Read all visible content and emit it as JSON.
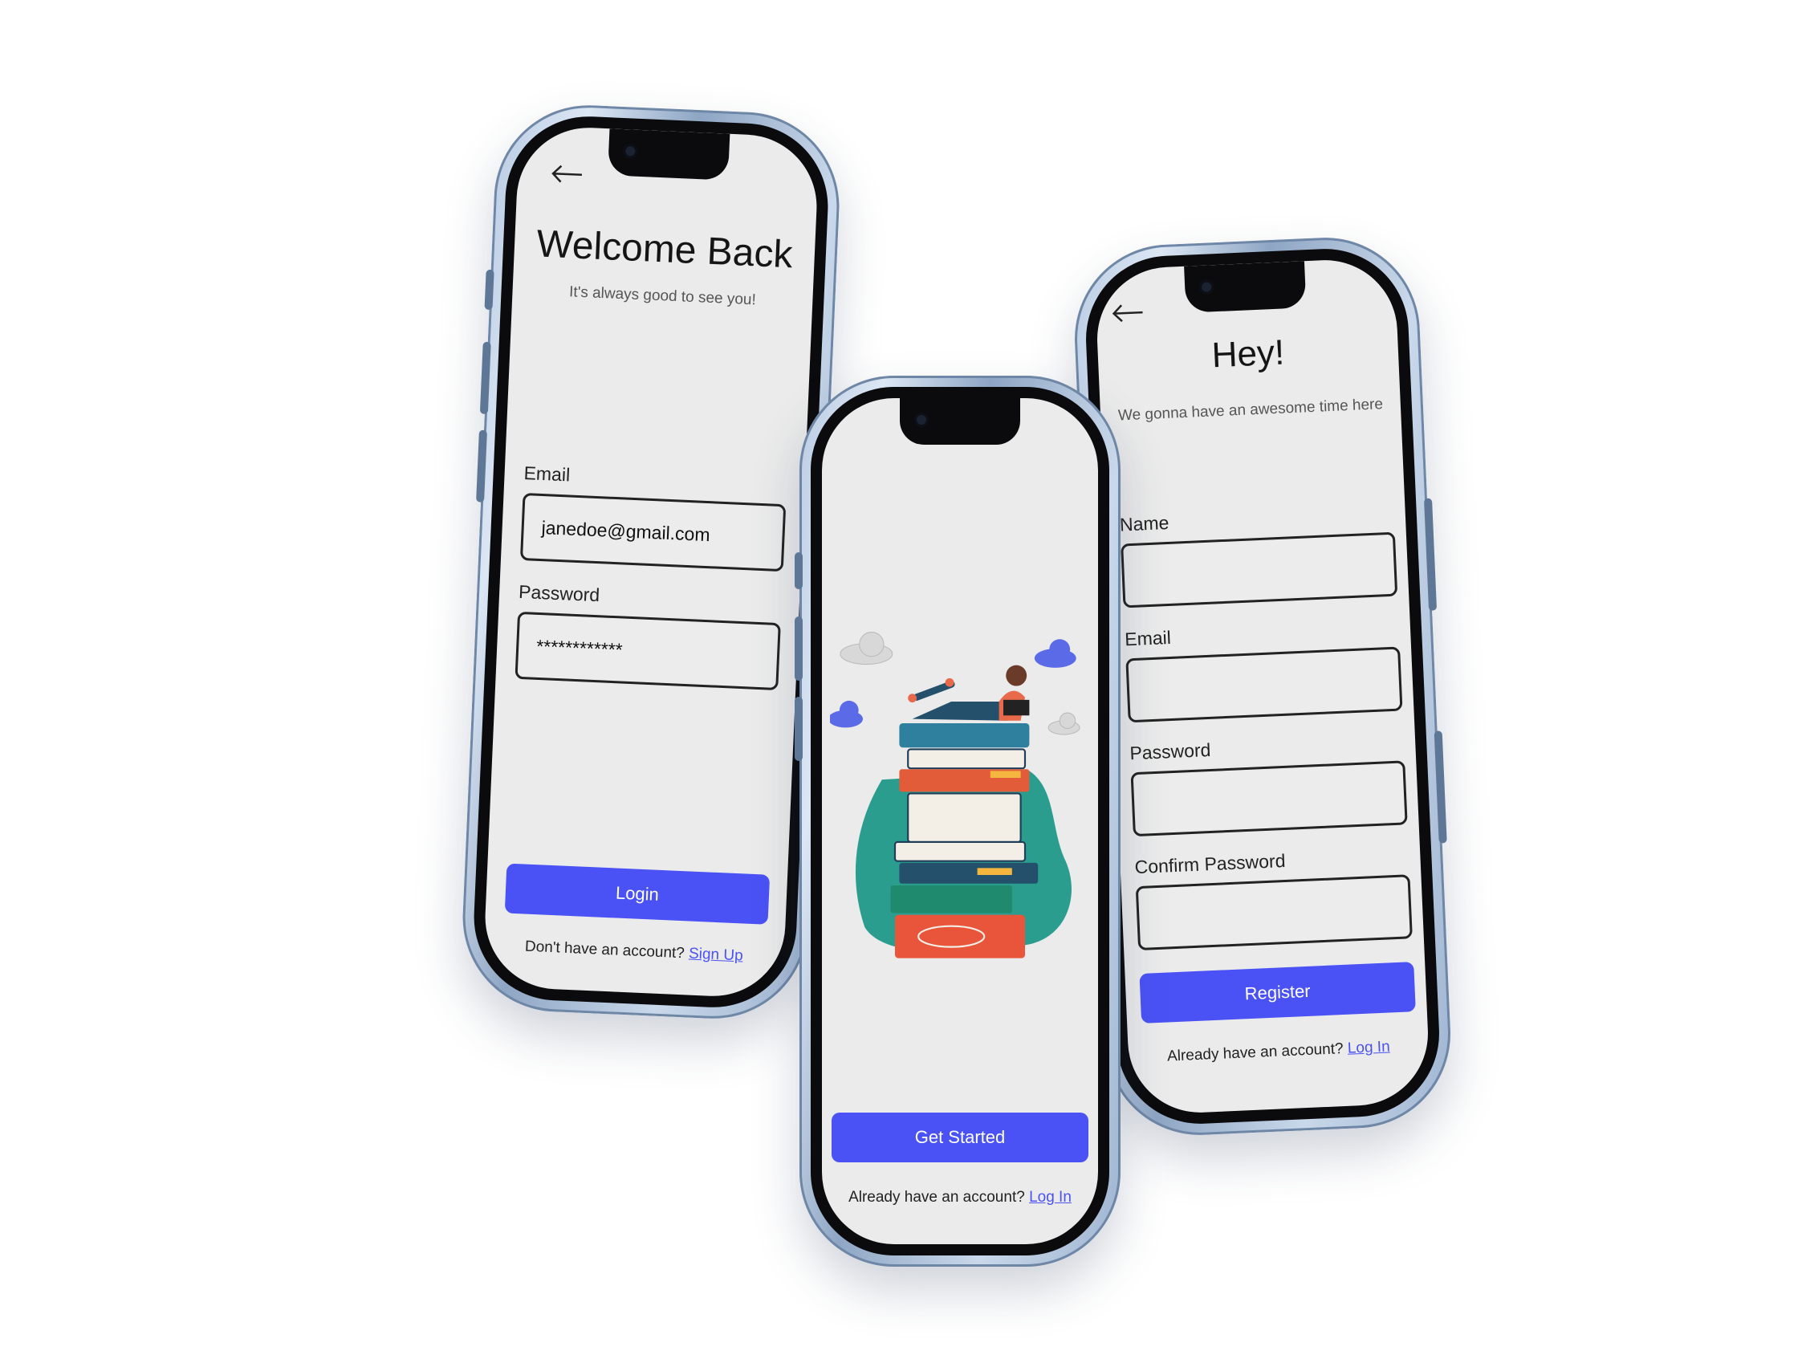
{
  "login": {
    "title": "Welcome Back",
    "subtitle": "It's always good to see you!",
    "email_label": "Email",
    "email_value": "janedoe@gmail.com",
    "password_label": "Password",
    "password_value": "************",
    "button_label": "Login",
    "footer_text": "Don't have an account?",
    "footer_link": "Sign Up"
  },
  "welcome": {
    "button_label": "Get Started",
    "footer_text": "Already have an account?",
    "footer_link": "Log In",
    "illustration": "stack-of-books-reader-illustration"
  },
  "register": {
    "title": "Hey!",
    "subtitle": "We gonna have an awesome time here",
    "name_label": "Name",
    "email_label": "Email",
    "password_label": "Password",
    "confirm_label": "Confirm Password",
    "button_label": "Register",
    "footer_text": "Already have an account?",
    "footer_link": "Log In"
  },
  "colors": {
    "accent": "#4a52f5",
    "screen": "#ebebeb",
    "frame": "#b9cbe3"
  },
  "icons": [
    "back-arrow-icon",
    "cloud-icon"
  ]
}
